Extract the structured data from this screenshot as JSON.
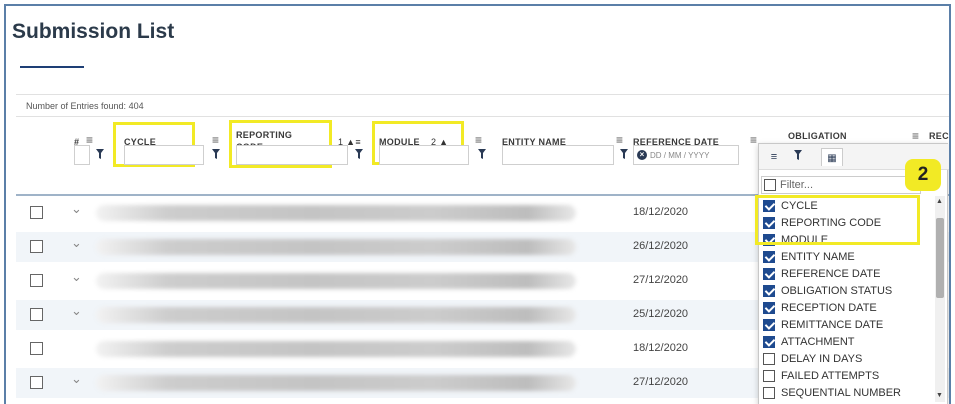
{
  "page": {
    "title": "Submission List"
  },
  "entries": {
    "label": "Number of Entries found:",
    "count": "404"
  },
  "columns": {
    "hash": "#",
    "cycle": "CYCLE",
    "reporting_code_1": "REPORTING",
    "reporting_code_2": "CODE",
    "reporting_sort": "1",
    "module": "MODULE",
    "module_sort": "2",
    "entity_name": "ENTITY NAME",
    "reference_date": "REFERENCE DATE",
    "obligation": "OBLIGATION",
    "partial_next": "REC"
  },
  "date_filter": {
    "placeholder": "DD / MM / YYYY"
  },
  "rows": [
    {
      "date": "18/12/2020",
      "expandable": true
    },
    {
      "date": "26/12/2020",
      "expandable": true
    },
    {
      "date": "27/12/2020",
      "expandable": true
    },
    {
      "date": "25/12/2020",
      "expandable": true
    },
    {
      "date": "18/12/2020",
      "expandable": false
    },
    {
      "date": "27/12/2020",
      "expandable": true
    }
  ],
  "chooser": {
    "filter_placeholder": "Filter...",
    "items": [
      {
        "label": "CYCLE",
        "checked": true
      },
      {
        "label": "REPORTING CODE",
        "checked": true
      },
      {
        "label": "MODULE",
        "checked": true
      },
      {
        "label": "ENTITY NAME",
        "checked": true
      },
      {
        "label": "REFERENCE DATE",
        "checked": true
      },
      {
        "label": "OBLIGATION STATUS",
        "checked": true
      },
      {
        "label": "RECEPTION DATE",
        "checked": true
      },
      {
        "label": "REMITTANCE DATE",
        "checked": true
      },
      {
        "label": "ATTACHMENT",
        "checked": true
      },
      {
        "label": "DELAY IN DAYS",
        "checked": false
      },
      {
        "label": "FAILED ATTEMPTS",
        "checked": false
      },
      {
        "label": "SEQUENTIAL NUMBER",
        "checked": false
      }
    ]
  },
  "annotation": {
    "badge": "2"
  },
  "colors": {
    "highlight": "#f2ea25",
    "accent": "#1e4a8f",
    "title": "#2b3a4a"
  }
}
